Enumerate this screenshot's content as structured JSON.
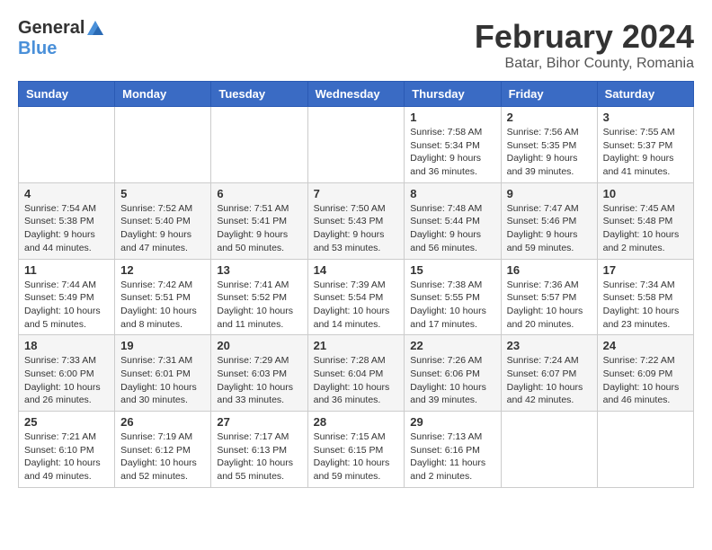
{
  "logo": {
    "general": "General",
    "blue": "Blue"
  },
  "title": "February 2024",
  "location": "Batar, Bihor County, Romania",
  "days_header": [
    "Sunday",
    "Monday",
    "Tuesday",
    "Wednesday",
    "Thursday",
    "Friday",
    "Saturday"
  ],
  "weeks": [
    [
      {
        "day": "",
        "info": ""
      },
      {
        "day": "",
        "info": ""
      },
      {
        "day": "",
        "info": ""
      },
      {
        "day": "",
        "info": ""
      },
      {
        "day": "1",
        "info": "Sunrise: 7:58 AM\nSunset: 5:34 PM\nDaylight: 9 hours\nand 36 minutes."
      },
      {
        "day": "2",
        "info": "Sunrise: 7:56 AM\nSunset: 5:35 PM\nDaylight: 9 hours\nand 39 minutes."
      },
      {
        "day": "3",
        "info": "Sunrise: 7:55 AM\nSunset: 5:37 PM\nDaylight: 9 hours\nand 41 minutes."
      }
    ],
    [
      {
        "day": "4",
        "info": "Sunrise: 7:54 AM\nSunset: 5:38 PM\nDaylight: 9 hours\nand 44 minutes."
      },
      {
        "day": "5",
        "info": "Sunrise: 7:52 AM\nSunset: 5:40 PM\nDaylight: 9 hours\nand 47 minutes."
      },
      {
        "day": "6",
        "info": "Sunrise: 7:51 AM\nSunset: 5:41 PM\nDaylight: 9 hours\nand 50 minutes."
      },
      {
        "day": "7",
        "info": "Sunrise: 7:50 AM\nSunset: 5:43 PM\nDaylight: 9 hours\nand 53 minutes."
      },
      {
        "day": "8",
        "info": "Sunrise: 7:48 AM\nSunset: 5:44 PM\nDaylight: 9 hours\nand 56 minutes."
      },
      {
        "day": "9",
        "info": "Sunrise: 7:47 AM\nSunset: 5:46 PM\nDaylight: 9 hours\nand 59 minutes."
      },
      {
        "day": "10",
        "info": "Sunrise: 7:45 AM\nSunset: 5:48 PM\nDaylight: 10 hours\nand 2 minutes."
      }
    ],
    [
      {
        "day": "11",
        "info": "Sunrise: 7:44 AM\nSunset: 5:49 PM\nDaylight: 10 hours\nand 5 minutes."
      },
      {
        "day": "12",
        "info": "Sunrise: 7:42 AM\nSunset: 5:51 PM\nDaylight: 10 hours\nand 8 minutes."
      },
      {
        "day": "13",
        "info": "Sunrise: 7:41 AM\nSunset: 5:52 PM\nDaylight: 10 hours\nand 11 minutes."
      },
      {
        "day": "14",
        "info": "Sunrise: 7:39 AM\nSunset: 5:54 PM\nDaylight: 10 hours\nand 14 minutes."
      },
      {
        "day": "15",
        "info": "Sunrise: 7:38 AM\nSunset: 5:55 PM\nDaylight: 10 hours\nand 17 minutes."
      },
      {
        "day": "16",
        "info": "Sunrise: 7:36 AM\nSunset: 5:57 PM\nDaylight: 10 hours\nand 20 minutes."
      },
      {
        "day": "17",
        "info": "Sunrise: 7:34 AM\nSunset: 5:58 PM\nDaylight: 10 hours\nand 23 minutes."
      }
    ],
    [
      {
        "day": "18",
        "info": "Sunrise: 7:33 AM\nSunset: 6:00 PM\nDaylight: 10 hours\nand 26 minutes."
      },
      {
        "day": "19",
        "info": "Sunrise: 7:31 AM\nSunset: 6:01 PM\nDaylight: 10 hours\nand 30 minutes."
      },
      {
        "day": "20",
        "info": "Sunrise: 7:29 AM\nSunset: 6:03 PM\nDaylight: 10 hours\nand 33 minutes."
      },
      {
        "day": "21",
        "info": "Sunrise: 7:28 AM\nSunset: 6:04 PM\nDaylight: 10 hours\nand 36 minutes."
      },
      {
        "day": "22",
        "info": "Sunrise: 7:26 AM\nSunset: 6:06 PM\nDaylight: 10 hours\nand 39 minutes."
      },
      {
        "day": "23",
        "info": "Sunrise: 7:24 AM\nSunset: 6:07 PM\nDaylight: 10 hours\nand 42 minutes."
      },
      {
        "day": "24",
        "info": "Sunrise: 7:22 AM\nSunset: 6:09 PM\nDaylight: 10 hours\nand 46 minutes."
      }
    ],
    [
      {
        "day": "25",
        "info": "Sunrise: 7:21 AM\nSunset: 6:10 PM\nDaylight: 10 hours\nand 49 minutes."
      },
      {
        "day": "26",
        "info": "Sunrise: 7:19 AM\nSunset: 6:12 PM\nDaylight: 10 hours\nand 52 minutes."
      },
      {
        "day": "27",
        "info": "Sunrise: 7:17 AM\nSunset: 6:13 PM\nDaylight: 10 hours\nand 55 minutes."
      },
      {
        "day": "28",
        "info": "Sunrise: 7:15 AM\nSunset: 6:15 PM\nDaylight: 10 hours\nand 59 minutes."
      },
      {
        "day": "29",
        "info": "Sunrise: 7:13 AM\nSunset: 6:16 PM\nDaylight: 11 hours\nand 2 minutes."
      },
      {
        "day": "",
        "info": ""
      },
      {
        "day": "",
        "info": ""
      }
    ]
  ]
}
